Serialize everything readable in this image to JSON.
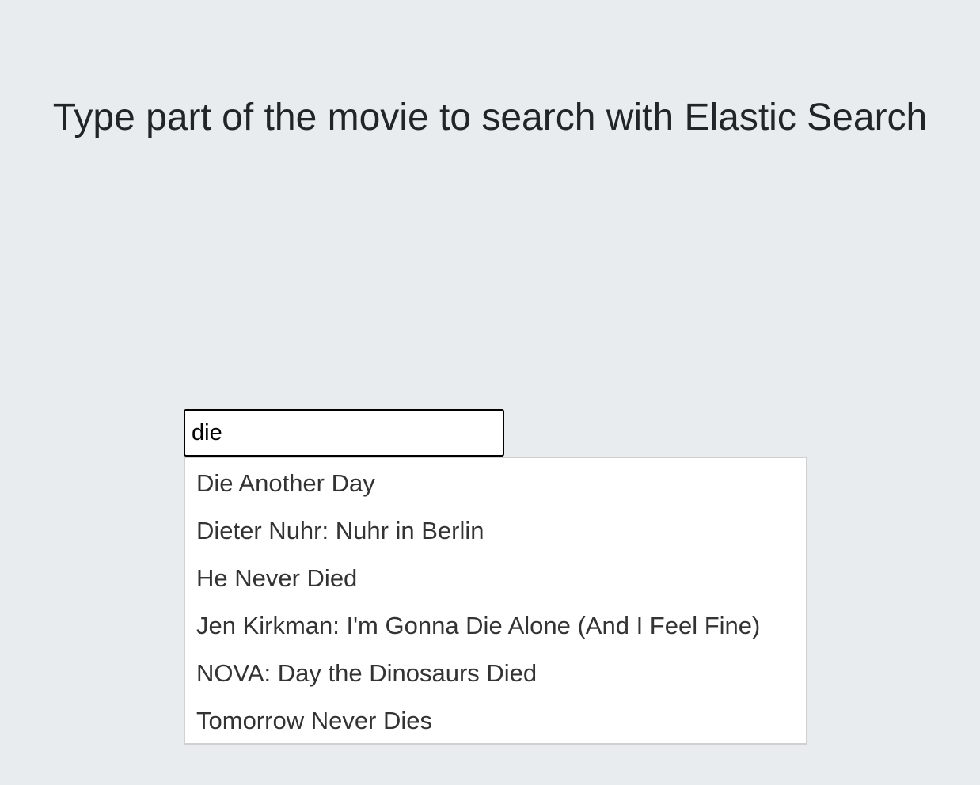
{
  "heading": "Type part of the movie to search with Elastic Search",
  "search": {
    "value": "die",
    "placeholder": ""
  },
  "suggestions": [
    "Die Another Day",
    "Dieter Nuhr: Nuhr in Berlin",
    "He Never Died",
    "Jen Kirkman: I'm Gonna Die Alone (And I Feel Fine)",
    "NOVA: Day the Dinosaurs Died",
    "Tomorrow Never Dies"
  ]
}
